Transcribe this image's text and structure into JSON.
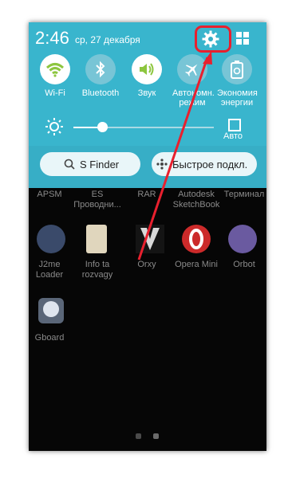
{
  "status": {
    "time": "2:46",
    "date": "ср, 27 декабря"
  },
  "toggles": [
    {
      "label": "Wi-Fi",
      "icon": "wifi-icon",
      "state": "on",
      "color": "#8dc63f"
    },
    {
      "label": "Bluetooth",
      "icon": "bluetooth-icon",
      "state": "off"
    },
    {
      "label": "Звук",
      "icon": "volume-icon",
      "state": "on",
      "color": "#8dc63f"
    },
    {
      "label_line1": "Автономн.",
      "label_line2": "режим",
      "icon": "airplane-icon",
      "state": "off"
    },
    {
      "label_line1": "Экономия",
      "label_line2": "энергии",
      "icon": "battery-recycle-icon",
      "state": "off"
    }
  ],
  "brightness": {
    "auto_label": "Авто",
    "level": 0.2
  },
  "buttons": {
    "s_finder": "S Finder",
    "quick_connect": "Быстрое подкл."
  },
  "apps_row1": [
    {
      "line1": "APSM",
      "line2": ""
    },
    {
      "line1": "ES",
      "line2": "Проводни..."
    },
    {
      "line1": "RAR",
      "line2": ""
    },
    {
      "line1": "Autodesk",
      "line2": "SketchBook"
    },
    {
      "line1": "Терминал",
      "line2": ""
    }
  ],
  "apps_row2": [
    {
      "line1": "J2me",
      "line2": "Loader",
      "icon": "java-icon"
    },
    {
      "line1": "Info ta",
      "line2": "rozvagy",
      "icon": "sim-settings-icon"
    },
    {
      "line1": "Orxy",
      "line2": "",
      "icon": "orxy-icon"
    },
    {
      "line1": "Opera Mini",
      "line2": "",
      "icon": "opera-mini-icon"
    },
    {
      "line1": "Orbot",
      "line2": "",
      "icon": "orbot-icon"
    }
  ],
  "apps_row3": [
    {
      "line1": "Gboard",
      "line2": "",
      "icon": "gboard-icon"
    }
  ],
  "accent_colors": {
    "panel": "#37aec6",
    "highlight": "#e8202e",
    "toggle_on": "#8dc63f"
  }
}
